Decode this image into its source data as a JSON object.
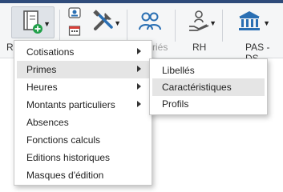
{
  "ribbon": {
    "groups": [
      {
        "label": "R",
        "faded": false
      },
      {
        "label": "riés",
        "faded": true
      },
      {
        "label": "RH",
        "faded": false
      },
      {
        "label": "PAS - DS",
        "faded": false
      }
    ],
    "icons": [
      "book-add-icon",
      "id-card-icon",
      "calendar-icon",
      "tools-icon",
      "people-icon",
      "hand-person-icon",
      "bank-icon"
    ]
  },
  "menu": {
    "items": [
      {
        "label": "Cotisations",
        "submenu": true
      },
      {
        "label": "Primes",
        "submenu": true,
        "highlighted": true
      },
      {
        "label": "Heures",
        "submenu": true
      },
      {
        "label": "Montants particuliers",
        "submenu": true
      },
      {
        "label": "Absences",
        "submenu": false
      },
      {
        "label": "Fonctions calculs",
        "submenu": false
      },
      {
        "label": "Editions historiques",
        "submenu": false
      },
      {
        "label": "Masques d'édition",
        "submenu": false
      }
    ]
  },
  "submenu": {
    "items": [
      {
        "label": "Libellés",
        "highlighted": false
      },
      {
        "label": "Caractéristiques",
        "highlighted": true
      },
      {
        "label": "Profils",
        "highlighted": false
      }
    ]
  },
  "colors": {
    "highlight": "#e5e5e5",
    "accent_green": "#21a04a",
    "accent_blue": "#2a6fb3"
  }
}
